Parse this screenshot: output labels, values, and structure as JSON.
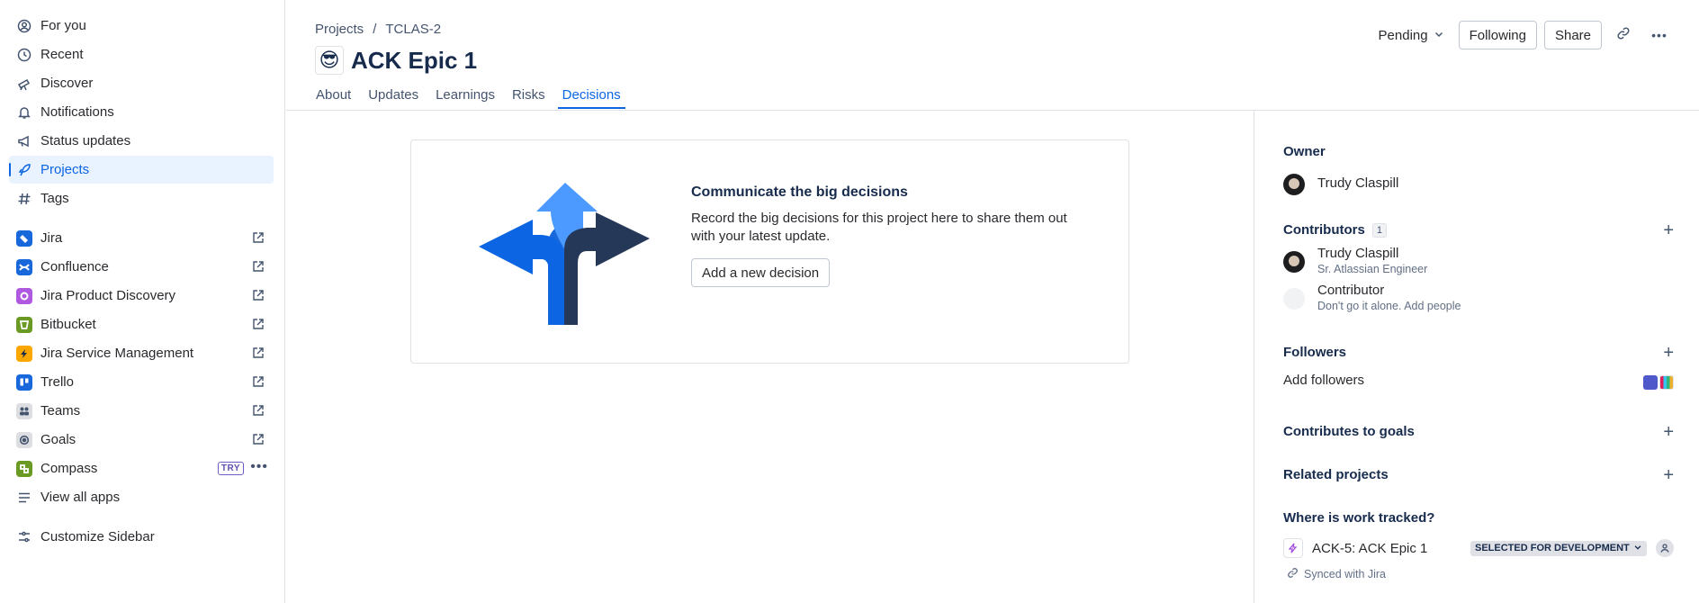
{
  "sidebar": {
    "items": [
      {
        "label": "For you",
        "icon": "person-icon"
      },
      {
        "label": "Recent",
        "icon": "clock-icon"
      },
      {
        "label": "Discover",
        "icon": "telescope-icon"
      },
      {
        "label": "Notifications",
        "icon": "bell-icon"
      },
      {
        "label": "Status updates",
        "icon": "megaphone-icon"
      },
      {
        "label": "Projects",
        "icon": "rocket-icon",
        "active": true
      },
      {
        "label": "Tags",
        "icon": "hash-icon"
      }
    ],
    "apps": [
      {
        "label": "Jira",
        "color": "#1868db"
      },
      {
        "label": "Confluence",
        "color": "#1868db"
      },
      {
        "label": "Jira Product Discovery",
        "color": "#af59e1"
      },
      {
        "label": "Bitbucket",
        "color": "#6a9a23"
      },
      {
        "label": "Jira Service Management",
        "color": "#fca700"
      },
      {
        "label": "Trello",
        "color": "#1868db"
      },
      {
        "label": "Teams",
        "color": "#dddee1"
      },
      {
        "label": "Goals",
        "color": "#dddee1"
      },
      {
        "label": "Compass",
        "color": "#6a9a23",
        "badge": "TRY"
      }
    ],
    "view_all": "View all apps",
    "customize": "Customize Sidebar"
  },
  "header": {
    "breadcrumb": [
      "Projects",
      "/",
      "TCLAS-2"
    ],
    "emoji": "😎",
    "title": "ACK Epic 1",
    "status": "Pending",
    "following": "Following",
    "share": "Share"
  },
  "tabs": [
    "About",
    "Updates",
    "Learnings",
    "Risks",
    "Decisions"
  ],
  "card": {
    "heading": "Communicate the big decisions",
    "body": "Record the big decisions for this project here to share them out with your latest update.",
    "button": "Add a new decision"
  },
  "panel": {
    "owner_heading": "Owner",
    "owner_name": "Trudy Claspill",
    "contributors_heading": "Contributors",
    "contributors_count": "1",
    "contributor_name": "Trudy Claspill",
    "contributor_role": "Sr. Atlassian Engineer",
    "contributor_placeholder": "Contributor",
    "contributor_placeholder_sub": "Don't go it alone. Add people",
    "followers_heading": "Followers",
    "add_followers": "Add followers",
    "goals_heading": "Contributes to goals",
    "related_heading": "Related projects",
    "tracked_heading": "Where is work tracked?",
    "tracked_item": "ACK-5: ACK Epic 1",
    "tracked_status": "SELECTED FOR DEVELOPMENT",
    "synced": "Synced with Jira"
  }
}
